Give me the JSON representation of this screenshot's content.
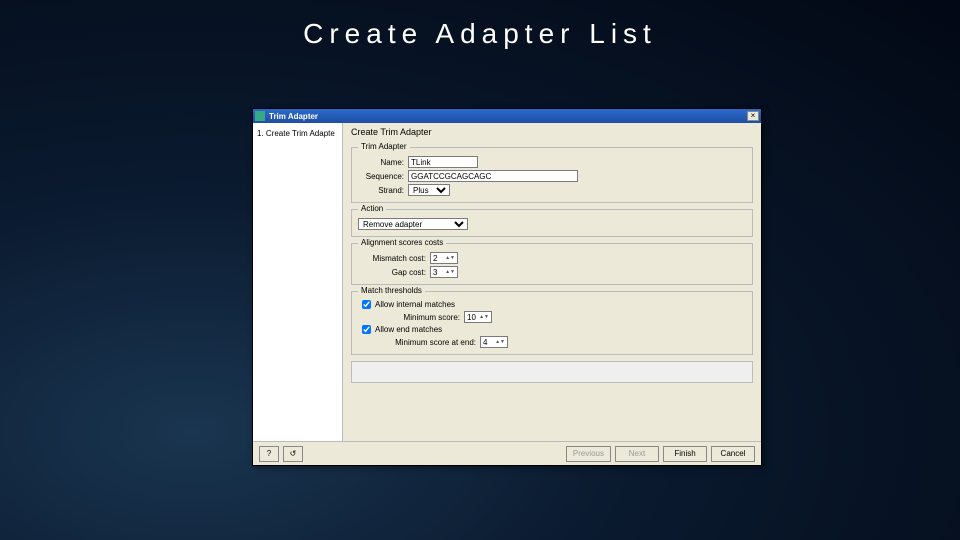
{
  "slide": {
    "title": "Create Adapter List"
  },
  "dialog": {
    "window_title": "Trim Adapter",
    "close_glyph": "×",
    "sidebar": {
      "items": [
        {
          "step": "1.",
          "label": "Create Trim Adapte"
        }
      ]
    },
    "main": {
      "title": "Create Trim Adapter",
      "groups": {
        "trim_adapter": {
          "legend": "Trim Adapter",
          "name_label": "Name:",
          "name_value": "TLink",
          "sequence_label": "Sequence:",
          "sequence_value": "GGATCCGCAGCAGC",
          "strand_label": "Strand:",
          "strand_value": "Plus"
        },
        "action": {
          "legend": "Action",
          "value": "Remove adapter"
        },
        "align_costs": {
          "legend": "Alignment scores costs",
          "mismatch_label": "Mismatch cost:",
          "mismatch_value": "2",
          "gap_label": "Gap cost:",
          "gap_value": "3"
        },
        "match_thresholds": {
          "legend": "Match thresholds",
          "allow_internal_label": "Allow internal matches",
          "allow_internal_checked": true,
          "min_score_label": "Minimum score:",
          "min_score_value": "10",
          "allow_end_label": "Allow end matches",
          "allow_end_checked": true,
          "min_score_end_label": "Minimum score at end:",
          "min_score_end_value": "4"
        }
      }
    },
    "footer": {
      "help": "?",
      "reset": "↺",
      "previous": "Previous",
      "next": "Next",
      "finish": "Finish",
      "cancel": "Cancel"
    }
  }
}
